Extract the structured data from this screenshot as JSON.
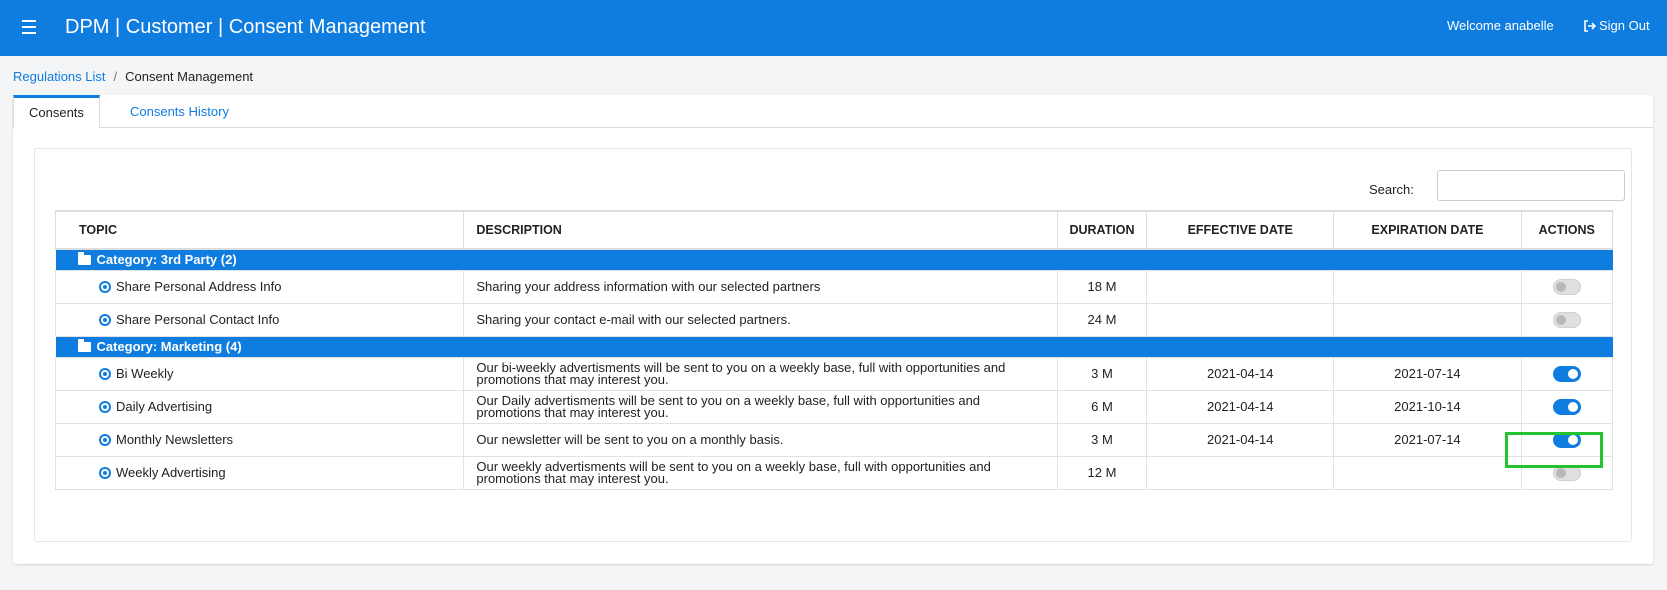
{
  "header": {
    "title": "DPM | Customer | Consent Management",
    "welcome": "Welcome anabelle",
    "signout": "Sign Out"
  },
  "breadcrumb": {
    "link": "Regulations List",
    "separator": "/",
    "current": "Consent Management"
  },
  "tabs": [
    {
      "label": "Consents"
    },
    {
      "label": "Consents History"
    }
  ],
  "search": {
    "label": "Search:",
    "value": ""
  },
  "table": {
    "headers": {
      "topic": "TOPIC",
      "description": "DESCRIPTION",
      "duration": "DURATION",
      "effective": "EFFECTIVE DATE",
      "expiration": "EXPIRATION DATE",
      "actions": "ACTIONS"
    },
    "categories": [
      {
        "label": "Category: 3rd Party (2)",
        "rows": [
          {
            "topic": "Share Personal Address Info",
            "description": "Sharing your address information with our selected partners",
            "duration": "18 M",
            "effective": "",
            "expiration": "",
            "enabled": false
          },
          {
            "topic": "Share Personal Contact Info",
            "description": "Sharing your contact e-mail with our selected partners.",
            "duration": "24 M",
            "effective": "",
            "expiration": "",
            "enabled": false
          }
        ]
      },
      {
        "label": "Category: Marketing (4)",
        "rows": [
          {
            "topic": "Bi Weekly",
            "description": "Our bi-weekly advertisments will be sent to you on a weekly base, full with opportunities and promotions that may interest you.",
            "duration": "3 M",
            "effective": "2021-04-14",
            "expiration": "2021-07-14",
            "enabled": true
          },
          {
            "topic": "Daily Advertising",
            "description": "Our Daily advertisments will be sent to you on a weekly base, full with opportunities and promotions that may interest you.",
            "duration": "6 M",
            "effective": "2021-04-14",
            "expiration": "2021-10-14",
            "enabled": true
          },
          {
            "topic": "Monthly Newsletters",
            "description": "Our newsletter will be sent to you on a monthly basis.",
            "duration": "3 M",
            "effective": "2021-04-14",
            "expiration": "2021-07-14",
            "enabled": true
          },
          {
            "topic": "Weekly Advertising",
            "description": "Our weekly advertisments will be sent to you on a weekly base, full with opportunities and promotions that may interest you.",
            "duration": "12 M",
            "effective": "",
            "expiration": "",
            "enabled": false
          }
        ]
      }
    ]
  },
  "colors": {
    "primary": "#0f7ce0",
    "highlight": "#22c32e"
  }
}
